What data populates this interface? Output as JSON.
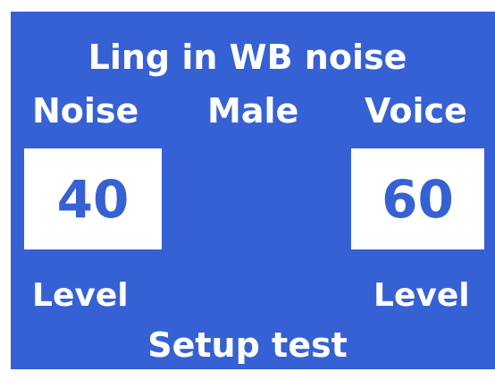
{
  "title": "Ling in WB noise",
  "columns": {
    "noise_label": "Noise",
    "talker_label": "Male",
    "voice_label": "Voice"
  },
  "noise": {
    "value": "40",
    "unit_label": "Level"
  },
  "voice": {
    "value": "60",
    "unit_label": "Level"
  },
  "actions": {
    "setup_label": "Setup test"
  },
  "colors": {
    "panel": "#3661d4",
    "text": "#ffffff",
    "box_background": "#ffffff",
    "box_text": "#3661d4"
  }
}
